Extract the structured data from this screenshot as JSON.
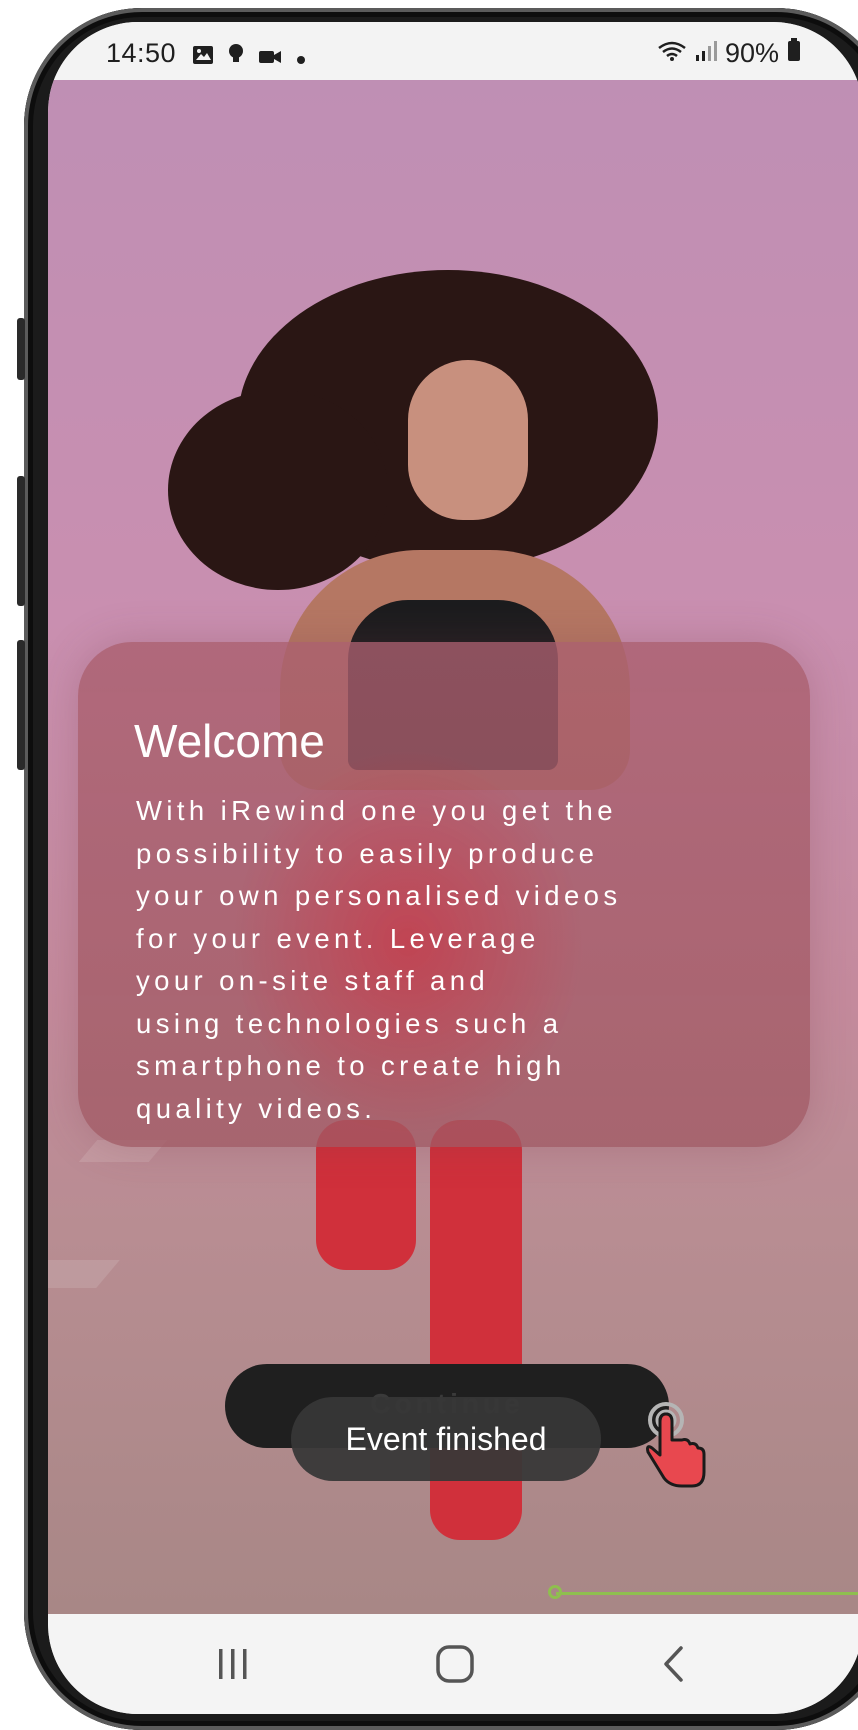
{
  "status_bar": {
    "time": "14:50",
    "battery": "90%",
    "left_icons": [
      "image-icon",
      "bulb-icon",
      "video-camera-icon",
      "dot-icon"
    ],
    "right_icons": [
      "wifi-icon",
      "signal-icon",
      "battery-icon"
    ]
  },
  "welcome": {
    "title": "Welcome",
    "body": "With iRewind one you get the\npossibility to easily produce\nyour own personalised videos\nfor your event. Leverage\nyour on-site staff and\nusing technologies such a\nsmartphone to create high\nquality videos."
  },
  "continue_button": {
    "label": "Continue"
  },
  "toast": {
    "text": "Event finished"
  },
  "nav_bar": {
    "buttons": [
      "recents-button",
      "home-button",
      "back-button"
    ]
  },
  "colors": {
    "hero_pink": "#c98fb0",
    "card_tint": "#a85f6e",
    "button_dark": "#1f1f1f",
    "toast_bg": "#373737",
    "guide_green": "#8fbf4f",
    "cursor_red": "#e8484f"
  }
}
